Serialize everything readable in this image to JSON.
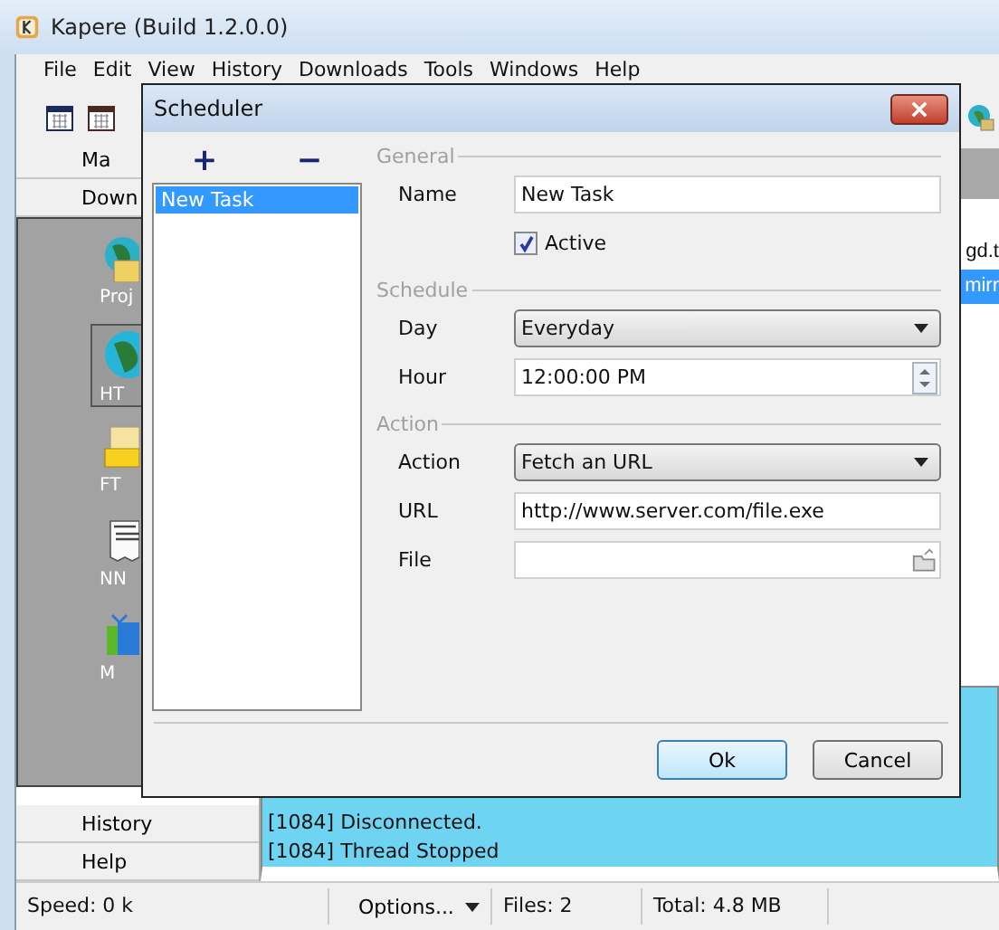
{
  "window": {
    "title": "Kapere (Build 1.2.0.0)"
  },
  "menu": [
    "File",
    "Edit",
    "View",
    "History",
    "Downloads",
    "Tools",
    "Windows",
    "Help"
  ],
  "sidebar": {
    "top_buttons": [
      "Ma",
      "Down"
    ],
    "items": [
      {
        "label": "Proj",
        "selected": false
      },
      {
        "label": "HT",
        "selected": true
      },
      {
        "label": "FT",
        "selected": false
      },
      {
        "label": "NN",
        "selected": false
      },
      {
        "label": "M",
        "selected": false
      }
    ],
    "bottom_buttons": [
      "History",
      "Help"
    ]
  },
  "downloads": {
    "rows": [
      {
        "text": "gd.t",
        "selected": false
      },
      {
        "text": "mirr",
        "selected": true
      }
    ]
  },
  "log": {
    "lines": [
      "[1084] Disconnected.",
      "[1084] Thread Stopped"
    ]
  },
  "status_bar": {
    "speed": "Speed: 0 k",
    "options": "Options...",
    "files": "Files: 2",
    "total": "Total: 4.8 MB"
  },
  "dialog": {
    "title": "Scheduler",
    "add": "+",
    "remove": "−",
    "tasks": [
      {
        "name": "New Task",
        "selected": true
      }
    ],
    "sections": [
      {
        "title": "General",
        "fields": [
          {
            "kind": "text",
            "label": "Name",
            "value": "New Task"
          },
          {
            "kind": "checkbox",
            "label": "Active",
            "checked": true
          }
        ]
      },
      {
        "title": "Schedule",
        "fields": [
          {
            "kind": "select",
            "label": "Day",
            "value": "Everyday"
          },
          {
            "kind": "spinner",
            "label": "Hour",
            "value": "12:00:00 PM"
          }
        ]
      },
      {
        "title": "Action",
        "fields": [
          {
            "kind": "select",
            "label": "Action",
            "value": "Fetch an URL"
          },
          {
            "kind": "text",
            "label": "URL",
            "value": "http://www.server.com/file.exe"
          },
          {
            "kind": "file",
            "label": "File"
          }
        ]
      }
    ],
    "buttons": [
      {
        "label": "Ok",
        "default": true
      },
      {
        "label": "Cancel",
        "default": false
      }
    ]
  }
}
